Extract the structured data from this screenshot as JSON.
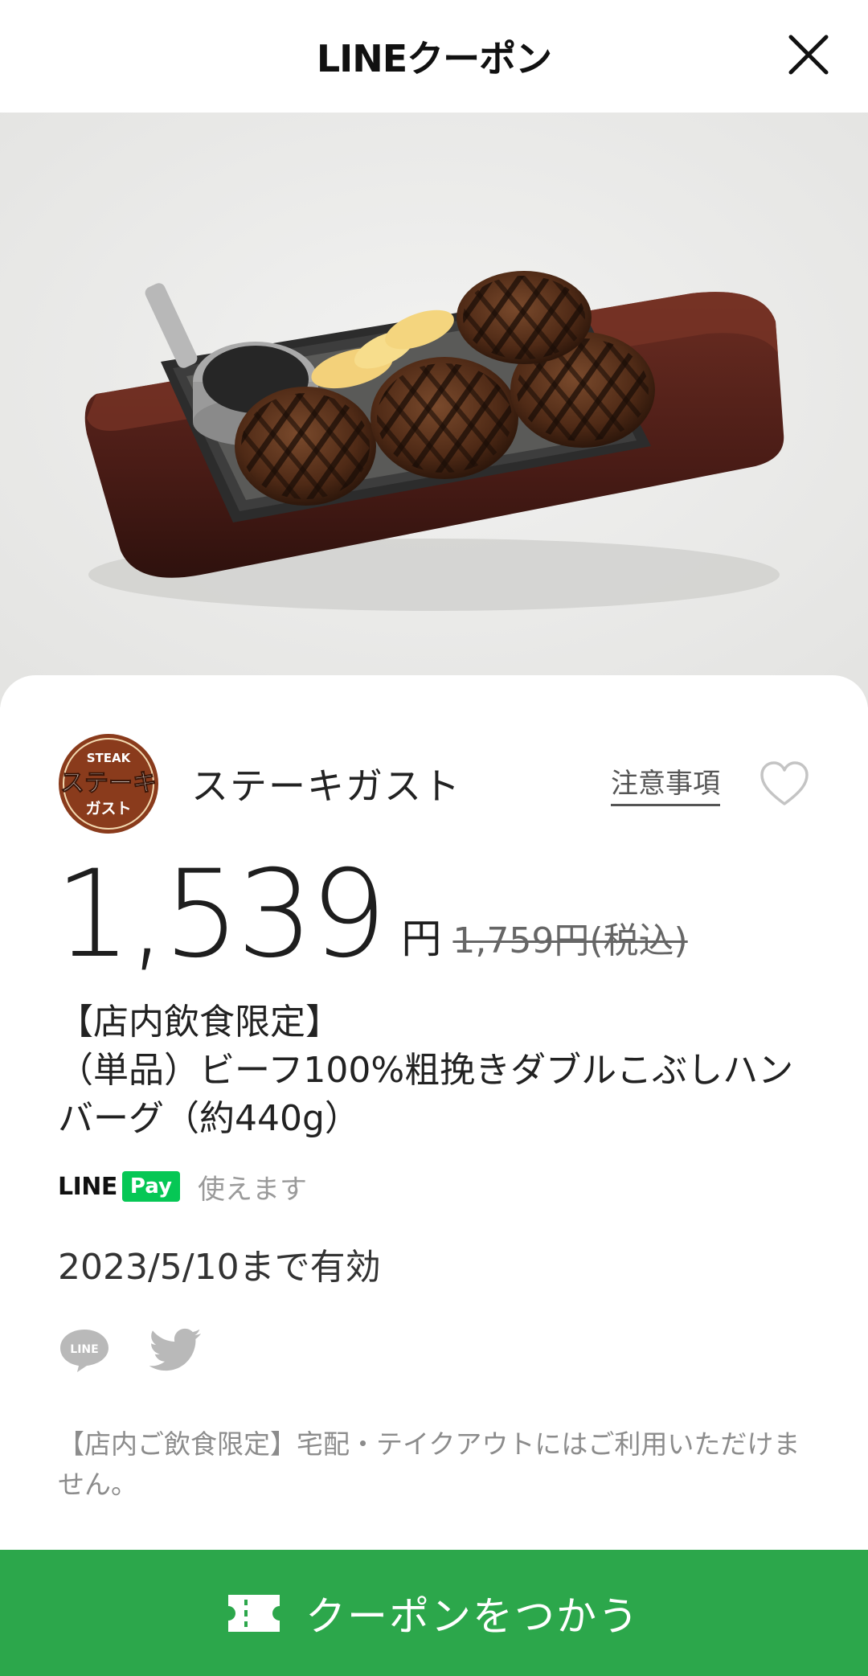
{
  "header": {
    "title": "LINEクーポン",
    "close_icon": "close-icon"
  },
  "hero": {
    "image_alt_icon": "hamburg-steak-plate-photo"
  },
  "store": {
    "logo_text_top": "STEAK",
    "logo_text_main": "ステーキ",
    "logo_text_bottom": "ガスト",
    "name": "ステーキガスト",
    "notice_link": "注意事項",
    "favorite_icon": "heart-icon"
  },
  "price": {
    "value": "1,539",
    "unit": "円",
    "original": "1,759円(税込)"
  },
  "coupon": {
    "title_line1": "【店内飲食限定】",
    "title_line2": "（単品）ビーフ100%粗挽きダブルこぶしハンバーグ（約440g）"
  },
  "payment": {
    "logo_line": "LINE",
    "logo_pay": "Pay",
    "text": "使えます"
  },
  "validity": "2023/5/10まで有効",
  "share": {
    "line_icon": "line-share-icon",
    "line_icon_text": "LINE",
    "twitter_icon": "twitter-share-icon"
  },
  "terms": "【店内ご飲食限定】宅配・テイクアウトにはご利用いただけません。",
  "cta": {
    "label": "クーポンをつかう",
    "icon": "ticket-icon"
  },
  "colors": {
    "accent_green": "#2ca74b",
    "line_pay_green": "#06c755",
    "logo_brown": "#8a3b1c"
  }
}
